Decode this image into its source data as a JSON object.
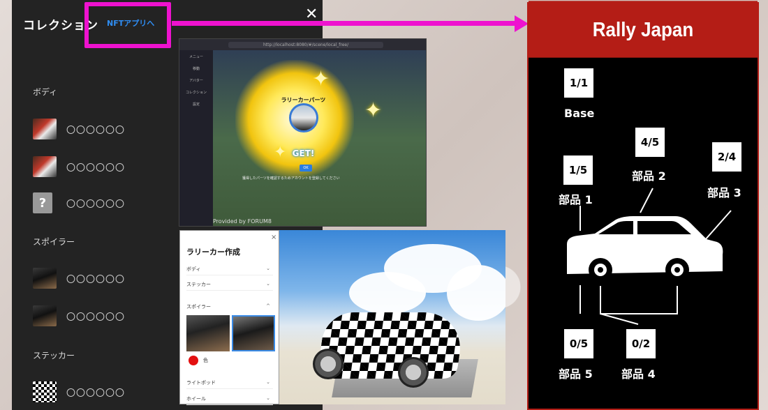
{
  "collection": {
    "title": "コレクション",
    "nft_link": "NFTアプリへ",
    "close": "✕",
    "sections": [
      {
        "title": "ボディ",
        "items": [
          {
            "label": "〇〇〇〇〇〇"
          },
          {
            "label": "〇〇〇〇〇〇"
          },
          {
            "label": "〇〇〇〇〇〇",
            "thumb": "?"
          }
        ]
      },
      {
        "title": "スポイラー",
        "items": [
          {
            "label": "〇〇〇〇〇〇"
          },
          {
            "label": "〇〇〇〇〇〇"
          }
        ]
      },
      {
        "title": "ステッカー",
        "items": [
          {
            "label": "〇〇〇〇〇〇"
          }
        ]
      }
    ]
  },
  "browser": {
    "url": "http://localhost:8080/#/scene/local_free/",
    "sidebar": [
      "メニュー",
      "移動",
      "アバター",
      "コレクション",
      "設定"
    ],
    "popup_title": "ラリーカーパーツ",
    "get_text": "GET!",
    "ok": "OK",
    "note": "獲得したパーツを確認するためアカウントを登録してください",
    "footer": "Provided by FORUM8"
  },
  "rally_creator": {
    "title": "ラリーカー作成",
    "close": "×",
    "items_top": [
      "ボディ",
      "ステッカー"
    ],
    "spoiler": "スポイラー",
    "color": "色",
    "items_bottom": [
      "ライトポッド",
      "ホイール"
    ]
  },
  "rally_panel": {
    "title": "Rally Japan",
    "base": {
      "count": "1/1",
      "label": "Base"
    },
    "parts": [
      {
        "count": "1/5",
        "label": "部品 1"
      },
      {
        "count": "4/5",
        "label": "部品 2"
      },
      {
        "count": "2/4",
        "label": "部品 3"
      },
      {
        "count": "0/2",
        "label": "部品 4"
      },
      {
        "count": "0/5",
        "label": "部品 5"
      }
    ]
  },
  "colors": {
    "accent_magenta": "#ee12cf",
    "rally_red": "#b41d16",
    "link_blue": "#2f8ef5"
  }
}
